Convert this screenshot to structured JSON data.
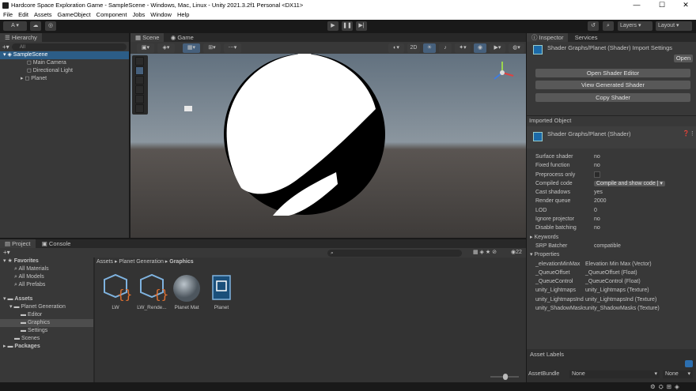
{
  "window": {
    "title": "Hardcore Space Exploration Game - SampleScene - Windows, Mac, Linux - Unity 2021.3.2f1 Personal <DX11>",
    "controls": [
      "—",
      "☐",
      "✕"
    ]
  },
  "menu": [
    "File",
    "Edit",
    "Assets",
    "GameObject",
    "Component",
    "Jobs",
    "Window",
    "Help"
  ],
  "toolbar": {
    "account_label": "A ▾",
    "layers_label": "Layers",
    "layout_label": "Layout"
  },
  "hierarchy": {
    "tab_label": "Hierarchy",
    "search_placeholder": "All",
    "scene_name": "SampleScene",
    "items": [
      "Main Camera",
      "Directional Light",
      "Planet"
    ]
  },
  "scene": {
    "tabs": [
      "Scene",
      "Game"
    ],
    "mode_2d": "2D"
  },
  "inspector": {
    "tabs": [
      "Inspector",
      "Services"
    ],
    "header_title": "Shader Graphs/Planet (Shader) Import Settings",
    "open_label": "Open",
    "buttons": [
      "Open Shader Editor",
      "View Generated Shader",
      "Copy Shader"
    ],
    "imported_object_label": "Imported Object",
    "object_title": "Shader Graphs/Planet (Shader)",
    "properties": [
      {
        "label": "Surface shader",
        "value": "no"
      },
      {
        "label": "Fixed function",
        "value": "no"
      },
      {
        "label": "Preprocess only",
        "value": ""
      },
      {
        "label": "Compiled code",
        "value": "Compile and show code | ▾"
      },
      {
        "label": "Cast shadows",
        "value": "yes"
      },
      {
        "label": "Render queue",
        "value": "2000"
      },
      {
        "label": "LOD",
        "value": "0"
      },
      {
        "label": "Ignore projector",
        "value": "no"
      },
      {
        "label": "Disable batching",
        "value": "no"
      }
    ],
    "keywords_label": "Keywords",
    "srp_label": "SRP Batcher",
    "srp_value": "compatible",
    "properties_label": "Properties",
    "shader_props": [
      {
        "label": "_elevationMinMax",
        "value": "Elevation Min Max (Vector)"
      },
      {
        "label": "_QueueOffset",
        "value": "_QueueOffset (Float)"
      },
      {
        "label": "_QueueControl",
        "value": "_QueueControl (Float)"
      },
      {
        "label": "unity_Lightmaps",
        "value": "unity_Lightmaps (Texture)"
      },
      {
        "label": "unity_LightmapsInd",
        "value": "unity_LightmapsInd (Texture)"
      },
      {
        "label": "unity_ShadowMasks",
        "value": "unity_ShadowMasks (Texture)"
      }
    ],
    "asset_labels": "Asset Labels",
    "asset_bundle_label": "AssetBundle",
    "asset_bundle_value": "None",
    "asset_bundle_variant": "None"
  },
  "project": {
    "tabs": [
      "Project",
      "Console"
    ],
    "favorites_label": "Favorites",
    "favorites": [
      "All Materials",
      "All Models",
      "All Prefabs"
    ],
    "assets_label": "Assets",
    "tree": [
      "Planet Generation",
      "Editor",
      "Graphics",
      "Settings",
      "Scenes"
    ],
    "packages_label": "Packages",
    "breadcrumb": [
      "Assets",
      "Planet Generation",
      "Graphics"
    ],
    "hidden_count": "22",
    "files": [
      "LW",
      "LW_Rende...",
      "Planet Mat",
      "Planet"
    ]
  }
}
